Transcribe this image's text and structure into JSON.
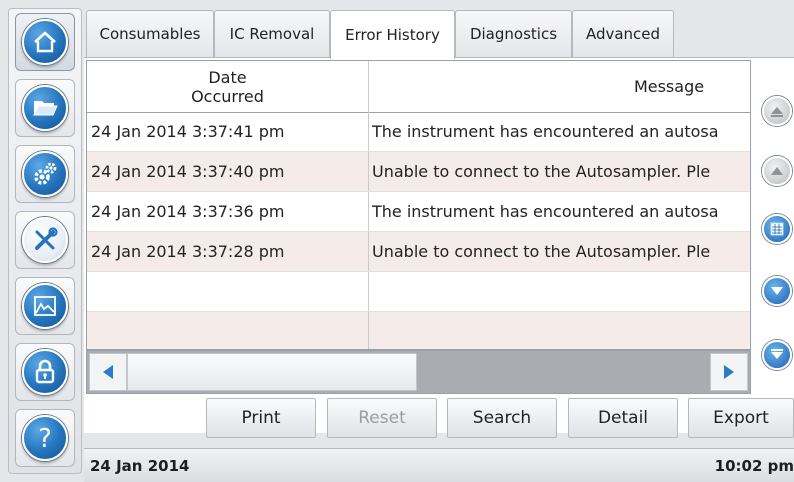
{
  "tabs": [
    {
      "label": "Consumables"
    },
    {
      "label": "IC Removal"
    },
    {
      "label": "Error History"
    },
    {
      "label": "Diagnostics"
    },
    {
      "label": "Advanced"
    }
  ],
  "active_tab": "Error History",
  "table": {
    "headers": {
      "date": "Date\nOccurred",
      "message": "Message"
    },
    "rows": [
      {
        "date": "24 Jan 2014 3:37:41 pm",
        "message": "The instrument has encountered an autosa"
      },
      {
        "date": "24 Jan 2014 3:37:40 pm",
        "message": "Unable to connect to the Autosampler.  Ple"
      },
      {
        "date": "24 Jan 2014 3:37:36 pm",
        "message": "The instrument has encountered an autosa"
      },
      {
        "date": "24 Jan 2014 3:37:28 pm",
        "message": "Unable to connect to the Autosampler.  Ple"
      },
      {
        "date": "",
        "message": ""
      },
      {
        "date": "",
        "message": ""
      }
    ]
  },
  "buttons": {
    "print": "Print",
    "reset": "Reset",
    "search": "Search",
    "detail": "Detail",
    "export": "Export"
  },
  "status": {
    "date": "24 Jan 2014",
    "time": "10:02 pm"
  },
  "icons": {
    "sidebar": [
      "home-icon",
      "folder-icon",
      "gears-icon",
      "tools-icon",
      "chart-icon",
      "lock-icon",
      "help-icon"
    ],
    "scroll": [
      "scroll-top-icon",
      "scroll-up-icon",
      "page-icon",
      "scroll-down-icon",
      "scroll-bottom-icon"
    ]
  },
  "colors": {
    "accent": "#2474bd",
    "row_alt": "#f5ecea",
    "scrollbar": "#a9adb2"
  }
}
